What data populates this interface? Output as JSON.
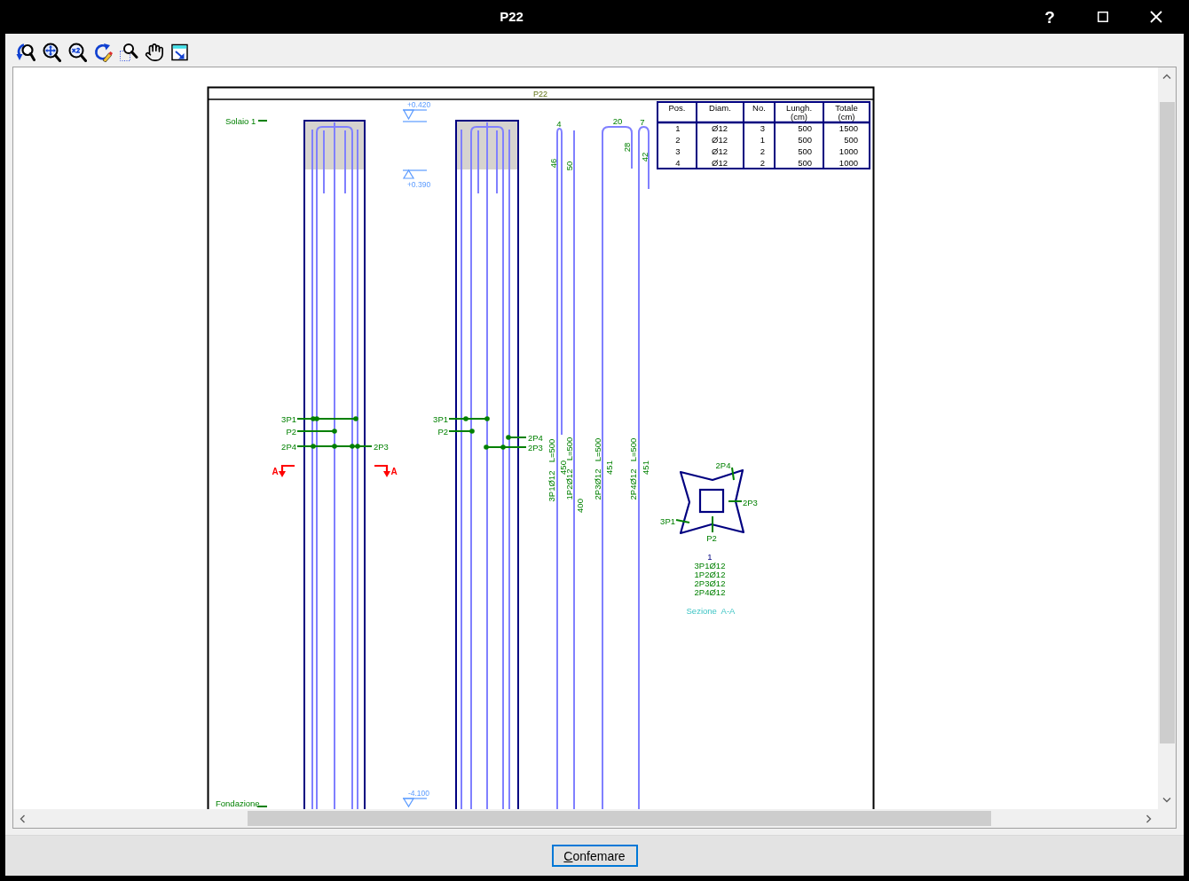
{
  "window": {
    "title": "P22",
    "help": "?"
  },
  "drawing": {
    "sheet_title": "P22",
    "floor_label": "Solaio 1",
    "foundation_label": "Fondazione",
    "levels": [
      "+0.420",
      "+0.390",
      "-4.100"
    ],
    "elevations": [
      {
        "callouts": [
          "3P1",
          "P2",
          "2P4",
          "2P3"
        ]
      },
      {
        "callouts": [
          "3P1",
          "P2",
          "2P4",
          "2P3"
        ]
      }
    ],
    "section_cut": [
      "A",
      "A"
    ],
    "bars": [
      {
        "top_dims": [
          "4",
          "46"
        ],
        "mark": "3P1Ø12",
        "length": "L=500",
        "span": "450"
      },
      {
        "top_dims": [
          "50"
        ],
        "mark": "1P2Ø12",
        "length": "L=500",
        "span": "400"
      },
      {
        "top_dims": [
          "20",
          "28"
        ],
        "mark": "2P3Ø12",
        "length": "L=500",
        "span": "451"
      },
      {
        "top_dims": [
          "7",
          "42"
        ],
        "mark": "2P4Ø12",
        "length": "L=500",
        "span": "451"
      }
    ],
    "schedule": {
      "columns": [
        {
          "label": "Pos."
        },
        {
          "label": "Diam."
        },
        {
          "label": "No."
        },
        {
          "label": "Lungh.",
          "unit": "(cm)"
        },
        {
          "label": "Totale",
          "unit": "(cm)"
        }
      ],
      "rows": [
        [
          "1",
          "Ø12",
          "3",
          "500",
          "1500"
        ],
        [
          "2",
          "Ø12",
          "1",
          "500",
          "500"
        ],
        [
          "3",
          "Ø12",
          "2",
          "500",
          "1000"
        ],
        [
          "4",
          "Ø12",
          "2",
          "500",
          "1000"
        ]
      ]
    },
    "section": {
      "bars": [
        "2P4",
        "2P3",
        "3P1",
        "P2"
      ],
      "number": "1",
      "legend": [
        "3P1Ø12",
        "1P2Ø12",
        "2P3Ø12",
        "2P4Ø12"
      ],
      "title": "Sezione  A-A"
    }
  },
  "buttons": [
    {
      "label": "Confemare"
    }
  ]
}
